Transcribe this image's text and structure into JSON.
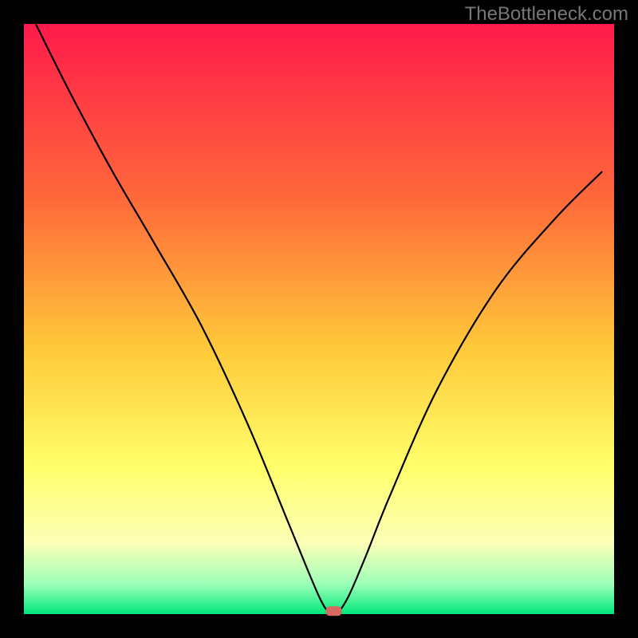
{
  "watermark": "TheBottleneck.com",
  "chart_data": {
    "type": "line",
    "title": "",
    "xlabel": "",
    "ylabel": "",
    "xlim": [
      0,
      100
    ],
    "ylim": [
      0,
      100
    ],
    "grid": false,
    "series": [
      {
        "name": "bottleneck-curve",
        "x": [
          2,
          8,
          15,
          22,
          30,
          38,
          45,
          50,
          52,
          53,
          55,
          58,
          62,
          70,
          80,
          90,
          98
        ],
        "y": [
          100,
          88,
          75,
          63,
          49,
          32,
          15,
          3,
          0,
          0,
          3,
          10,
          20,
          38,
          55,
          67,
          75
        ]
      }
    ],
    "marker": {
      "name": "optimal-point",
      "x": 52.5,
      "y": 0.5,
      "color": "#d66a63"
    },
    "gradient_stops": [
      {
        "offset": 0,
        "color": "#ff1a4b"
      },
      {
        "offset": 30,
        "color": "#ff6a3a"
      },
      {
        "offset": 55,
        "color": "#ffc93a"
      },
      {
        "offset": 75,
        "color": "#ffff6a"
      },
      {
        "offset": 88,
        "color": "#fdffb8"
      },
      {
        "offset": 95,
        "color": "#9bffb8"
      },
      {
        "offset": 100,
        "color": "#00e87a"
      }
    ],
    "frame_color": "#000000",
    "frame_inset": 30,
    "frame_width": 740
  }
}
